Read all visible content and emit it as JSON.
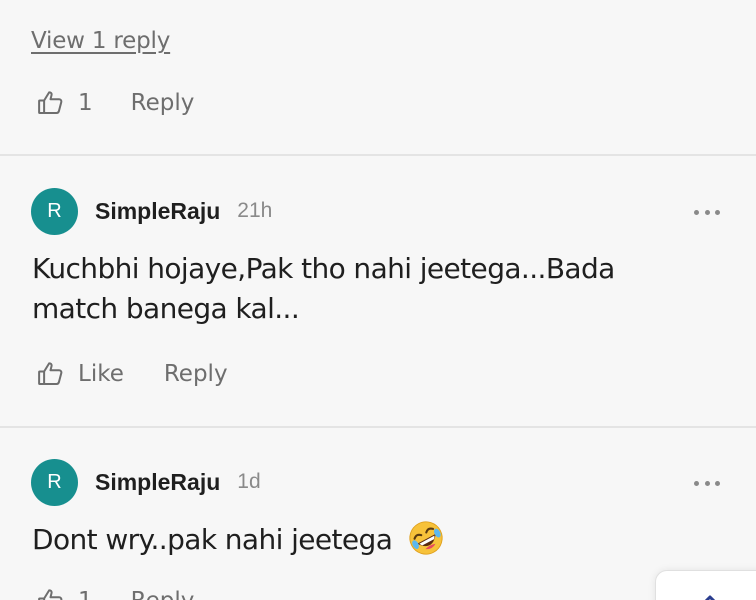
{
  "thread": {
    "view_replies_label": "View 1 reply",
    "prev_actions": {
      "like_count": "1",
      "reply_label": "Reply"
    }
  },
  "comments": [
    {
      "avatar_letter": "R",
      "username": "SimpleRaju",
      "timestamp": "21h",
      "text": "Kuchbhi hojaye,Pak tho nahi jeetega...Bada match banega kal...",
      "like_label": "Like",
      "reply_label": "Reply"
    },
    {
      "avatar_letter": "R",
      "username": "SimpleRaju",
      "timestamp": "1d",
      "text": "Dont wry..pak nahi jeetega",
      "emoji": "rolling-on-floor-laughing",
      "like_count": "1",
      "reply_label": "Reply"
    }
  ],
  "colors": {
    "avatar_bg": "#178f8f",
    "background": "#f7f7f7",
    "muted_text": "#6e6e6e"
  }
}
